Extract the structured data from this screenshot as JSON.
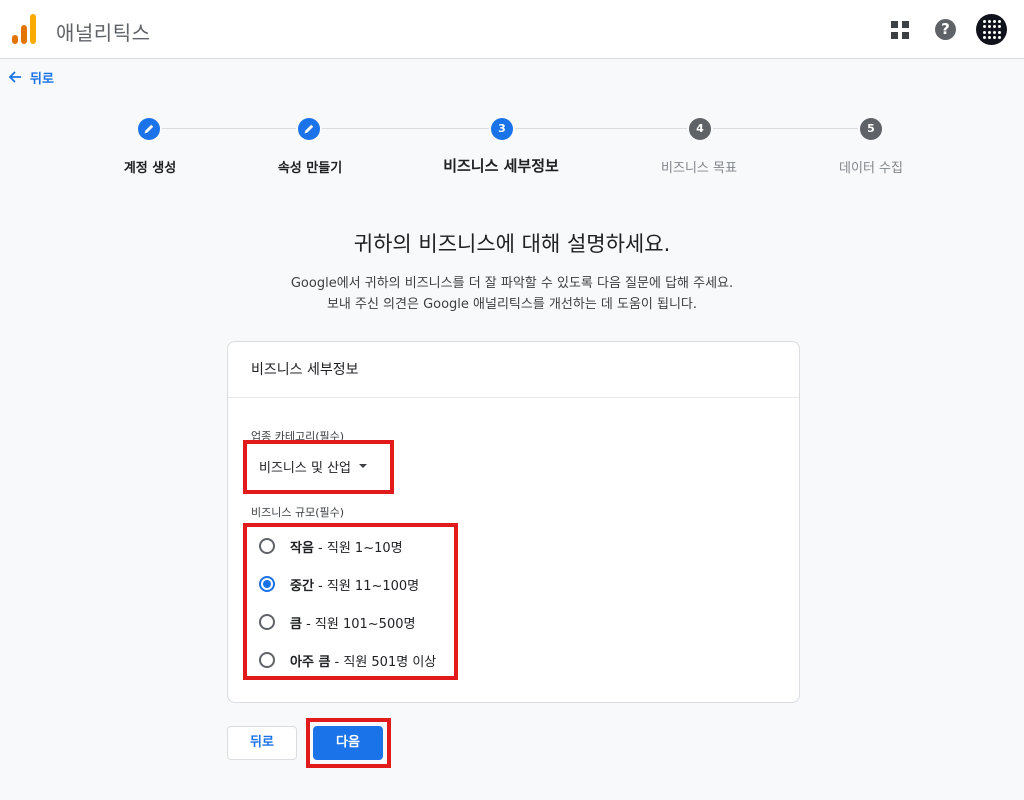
{
  "app": {
    "title": "애널리틱스",
    "logo_icon": "analytics-logo-icon",
    "apps_icon": "apps-grid-icon",
    "help_icon": "help-icon",
    "help_glyph": "?",
    "avatar_icon": "account-avatar-icon"
  },
  "nav": {
    "back_label": "뒤로"
  },
  "stepper": {
    "steps": [
      {
        "number": "1",
        "label": "계정 생성",
        "state": "done"
      },
      {
        "number": "2",
        "label": "속성 만들기",
        "state": "done"
      },
      {
        "number": "3",
        "label": "비즈니스 세부정보",
        "state": "active"
      },
      {
        "number": "4",
        "label": "비즈니스 목표",
        "state": "todo"
      },
      {
        "number": "5",
        "label": "데이터 수집",
        "state": "todo"
      }
    ]
  },
  "main": {
    "title": "귀하의 비즈니스에 대해 설명하세요.",
    "subtitle_line1": "Google에서 귀하의 비즈니스를 더 잘 파악할 수 있도록 다음 질문에 답해 주세요.",
    "subtitle_line2": "보내 주신 의견은 Google 애널리틱스를 개선하는 데 도움이 됩니다."
  },
  "card": {
    "title": "비즈니스 세부정보",
    "category_label": "업종 카테고리(필수)",
    "category_value": "비즈니스 및 산업",
    "size_label": "비즈니스 규모(필수)",
    "size_options": [
      {
        "name": "작음",
        "detail": " - 직원 1~10명",
        "checked": false
      },
      {
        "name": "중간",
        "detail": " - 직원 11~100명",
        "checked": true
      },
      {
        "name": "큼",
        "detail": " - 직원 101~500명",
        "checked": false
      },
      {
        "name": "아주 큼",
        "detail": " - 직원 501명 이상",
        "checked": false
      }
    ]
  },
  "buttons": {
    "back": "뒤로",
    "next": "다음"
  },
  "colors": {
    "accent": "#1a73e8",
    "highlight": "#e11b1b",
    "logo_orange": "#f9ab00",
    "logo_dark_orange": "#e37400"
  }
}
